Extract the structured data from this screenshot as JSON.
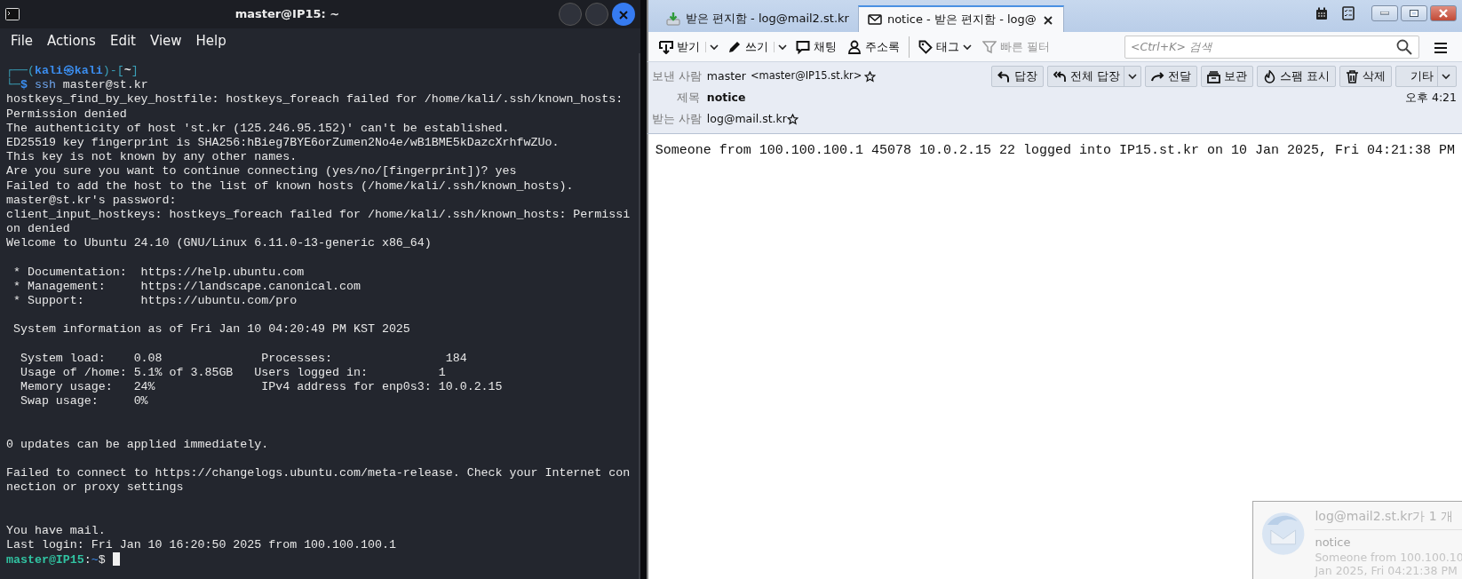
{
  "terminal": {
    "title": "master@IP15: ~",
    "menu": [
      "File",
      "Actions",
      "Edit",
      "View",
      "Help"
    ],
    "lines": [
      {
        "kind": "prompt",
        "segments": [
          {
            "text": "┌──(",
            "kind": "frame"
          },
          {
            "text": "kali㉿kali",
            "kind": "user"
          },
          {
            "text": ")-[",
            "kind": "frame"
          },
          {
            "text": "~",
            "kind": "path"
          },
          {
            "text": "]",
            "kind": "frame"
          }
        ]
      },
      {
        "kind": "prompt",
        "segments": [
          {
            "text": "└─",
            "kind": "frame"
          },
          {
            "text": "$",
            "kind": "user"
          },
          {
            "text": " ssh",
            "kind": "command"
          },
          {
            "text": " master@st.kr",
            "kind": "plain"
          }
        ]
      },
      {
        "kind": "output",
        "text": "hostkeys_find_by_key_hostfile: hostkeys_foreach failed for /home/kali/.ssh/known_hosts:"
      },
      {
        "kind": "output",
        "text": "Permission denied"
      },
      {
        "kind": "output",
        "text": "The authenticity of host 'st.kr (125.246.95.152)' can't be established."
      },
      {
        "kind": "output",
        "text": "ED25519 key fingerprint is SHA256:hBieg7BYE6orZumen2No4e/wB1BME5kDazcXrhfwZUo."
      },
      {
        "kind": "output",
        "text": "This key is not known by any other names."
      },
      {
        "kind": "output",
        "text": "Are you sure you want to continue connecting (yes/no/[fingerprint])? yes"
      },
      {
        "kind": "output",
        "text": "Failed to add the host to the list of known hosts (/home/kali/.ssh/known_hosts)."
      },
      {
        "kind": "output",
        "text": "master@st.kr's password:"
      },
      {
        "kind": "output",
        "text": "client_input_hostkeys: hostkeys_foreach failed for /home/kali/.ssh/known_hosts: Permissi"
      },
      {
        "kind": "output",
        "text": "on denied"
      },
      {
        "kind": "output",
        "text": "Welcome to Ubuntu 24.10 (GNU/Linux 6.11.0-13-generic x86_64)"
      },
      {
        "kind": "blank"
      },
      {
        "kind": "output",
        "text": " * Documentation:  https://help.ubuntu.com"
      },
      {
        "kind": "output",
        "text": " * Management:     https://landscape.canonical.com"
      },
      {
        "kind": "output",
        "text": " * Support:        https://ubuntu.com/pro"
      },
      {
        "kind": "blank"
      },
      {
        "kind": "output",
        "text": " System information as of Fri Jan 10 04:20:49 PM KST 2025"
      },
      {
        "kind": "blank"
      },
      {
        "kind": "output",
        "text": "  System load:    0.08              Processes:                184"
      },
      {
        "kind": "output",
        "text": "  Usage of /home: 5.1% of 3.85GB   Users logged in:          1"
      },
      {
        "kind": "output",
        "text": "  Memory usage:   24%               IPv4 address for enp0s3: 10.0.2.15"
      },
      {
        "kind": "output",
        "text": "  Swap usage:     0%"
      },
      {
        "kind": "blank"
      },
      {
        "kind": "blank"
      },
      {
        "kind": "output",
        "text": "0 updates can be applied immediately."
      },
      {
        "kind": "blank"
      },
      {
        "kind": "output",
        "text": "Failed to connect to https://changelogs.ubuntu.com/meta-release. Check your Internet con"
      },
      {
        "kind": "output",
        "text": "nection or proxy settings"
      },
      {
        "kind": "blank"
      },
      {
        "kind": "blank"
      },
      {
        "kind": "output",
        "text": "You have mail."
      },
      {
        "kind": "output",
        "text": "Last login: Fri Jan 10 16:20:50 2025 from 100.100.100.1"
      },
      {
        "kind": "prompt",
        "cursor": true,
        "segments": [
          {
            "text": "master@IP15",
            "kind": "host"
          },
          {
            "text": ":",
            "kind": "plain"
          },
          {
            "text": "~",
            "kind": "path"
          },
          {
            "text": "$",
            "kind": "plain"
          }
        ]
      }
    ]
  },
  "mail": {
    "tabs": [
      {
        "label": "받은 편지함 - log@mail2.st.kr",
        "selected": false,
        "closable": false
      },
      {
        "label": "notice - 받은 편지함 - log@",
        "selected": true,
        "closable": true
      }
    ],
    "toolbar_groups": [
      [
        {
          "label": "받기",
          "dropdown": true,
          "disabled": false
        },
        {
          "label": "쓰기",
          "dropdown": true,
          "disabled": false
        },
        {
          "label": "채팅",
          "dropdown": false,
          "disabled": false
        },
        {
          "label": "주소록",
          "dropdown": false,
          "disabled": false
        }
      ],
      [
        {
          "label": "태그",
          "dropdown": true,
          "disabled": false
        },
        {
          "label": "빠른 필터",
          "dropdown": false,
          "disabled": true
        }
      ]
    ],
    "search": {
      "placeholder": "<Ctrl+K> 검색"
    },
    "header": {
      "from_label": "보낸 사람",
      "from_name": "master",
      "from_address": "<master@IP15.st.kr>",
      "subject_label": "제목",
      "subject": "notice",
      "to_label": "받는 사람",
      "to": "log@mail.st.kr",
      "time": "오후 4:21"
    },
    "actions": [
      {
        "label": "답장",
        "dropdown": false
      },
      {
        "label": "전체 답장",
        "dropdown": true
      },
      {
        "label": "전달",
        "dropdown": false
      },
      {
        "label": "보관",
        "dropdown": false
      },
      {
        "label": "스팸 표시",
        "dropdown": false
      },
      {
        "label": "삭제",
        "dropdown": false
      },
      {
        "label": "기타",
        "dropdown": true
      }
    ],
    "body": "Someone from 100.100.100.1 45078 10.0.2.15 22 logged into IP15.st.kr on 10 Jan 2025, Fri 04:21:38 PM",
    "notification": {
      "title": "log@mail2.st.kr가 1 개",
      "subject": "notice",
      "preview": [
        "Someone from 100.100.10",
        "Jan 2025, Fri 04:21:38 PM"
      ]
    }
  }
}
